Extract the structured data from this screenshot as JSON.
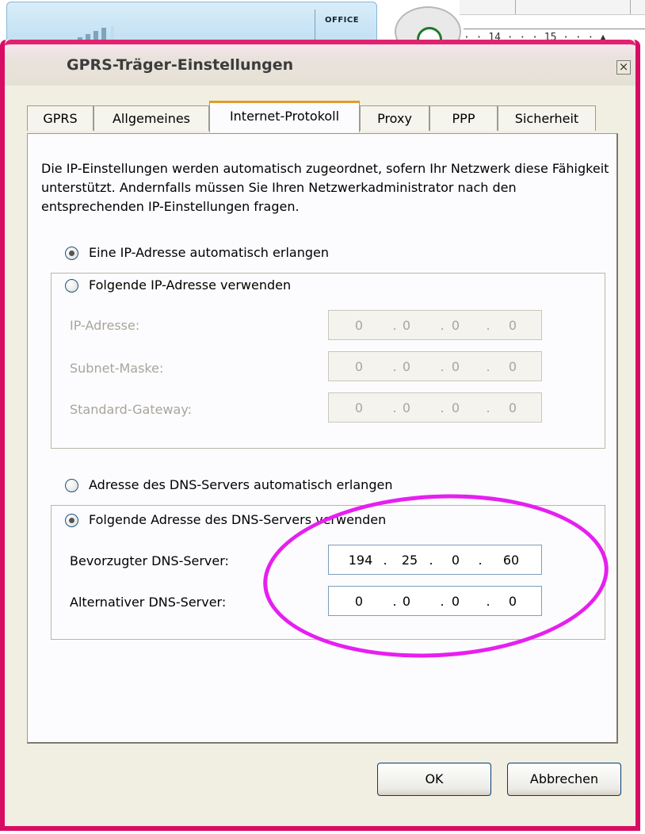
{
  "background": {
    "office_label": "OFFICE",
    "ruler_text": "· · 14 · · · 15 · · · ▲"
  },
  "dialog": {
    "title": "GPRS-Träger-Einstellungen",
    "close_glyph": "×"
  },
  "tabs": [
    {
      "label": "GPRS"
    },
    {
      "label": "Allgemeines"
    },
    {
      "label": "Internet-Protokoll"
    },
    {
      "label": "Proxy"
    },
    {
      "label": "PPP"
    },
    {
      "label": "Sicherheit"
    }
  ],
  "active_tab": "Internet-Protokoll",
  "intro": "Die IP-Einstellungen werden automatisch zugeordnet, sofern Ihr Netzwerk diese Fähigkeit unterstützt. Andernfalls müssen Sie Ihren Netzwerkadministrator nach den entsprechenden IP-Einstellungen fragen.",
  "ip": {
    "auto_label": "Eine IP-Adresse automatisch erlangen",
    "auto_selected": true,
    "manual_label": "Folgende IP-Adresse verwenden",
    "manual_selected": false,
    "fields": [
      {
        "label": "IP-Adresse:",
        "octets": [
          "0",
          "0",
          "0",
          "0"
        ]
      },
      {
        "label": "Subnet-Maske:",
        "octets": [
          "0",
          "0",
          "0",
          "0"
        ]
      },
      {
        "label": "Standard-Gateway:",
        "octets": [
          "0",
          "0",
          "0",
          "0"
        ]
      }
    ]
  },
  "dns": {
    "auto_label": "Adresse des DNS-Servers automatisch erlangen",
    "auto_selected": false,
    "manual_label": "Folgende Adresse des DNS-Servers verwenden",
    "manual_selected": true,
    "fields": [
      {
        "label": "Bevorzugter DNS-Server:",
        "octets": [
          "194",
          "25",
          "0",
          "60"
        ]
      },
      {
        "label": "Alternativer DNS-Server:",
        "octets": [
          "0",
          "0",
          "0",
          "0"
        ]
      }
    ]
  },
  "buttons": {
    "ok": "OK",
    "cancel": "Abbrechen"
  },
  "colors": {
    "frame_accent": "#d90c64",
    "annotation": "#e61ff0",
    "active_tab_highlight": "#e39a2e"
  }
}
